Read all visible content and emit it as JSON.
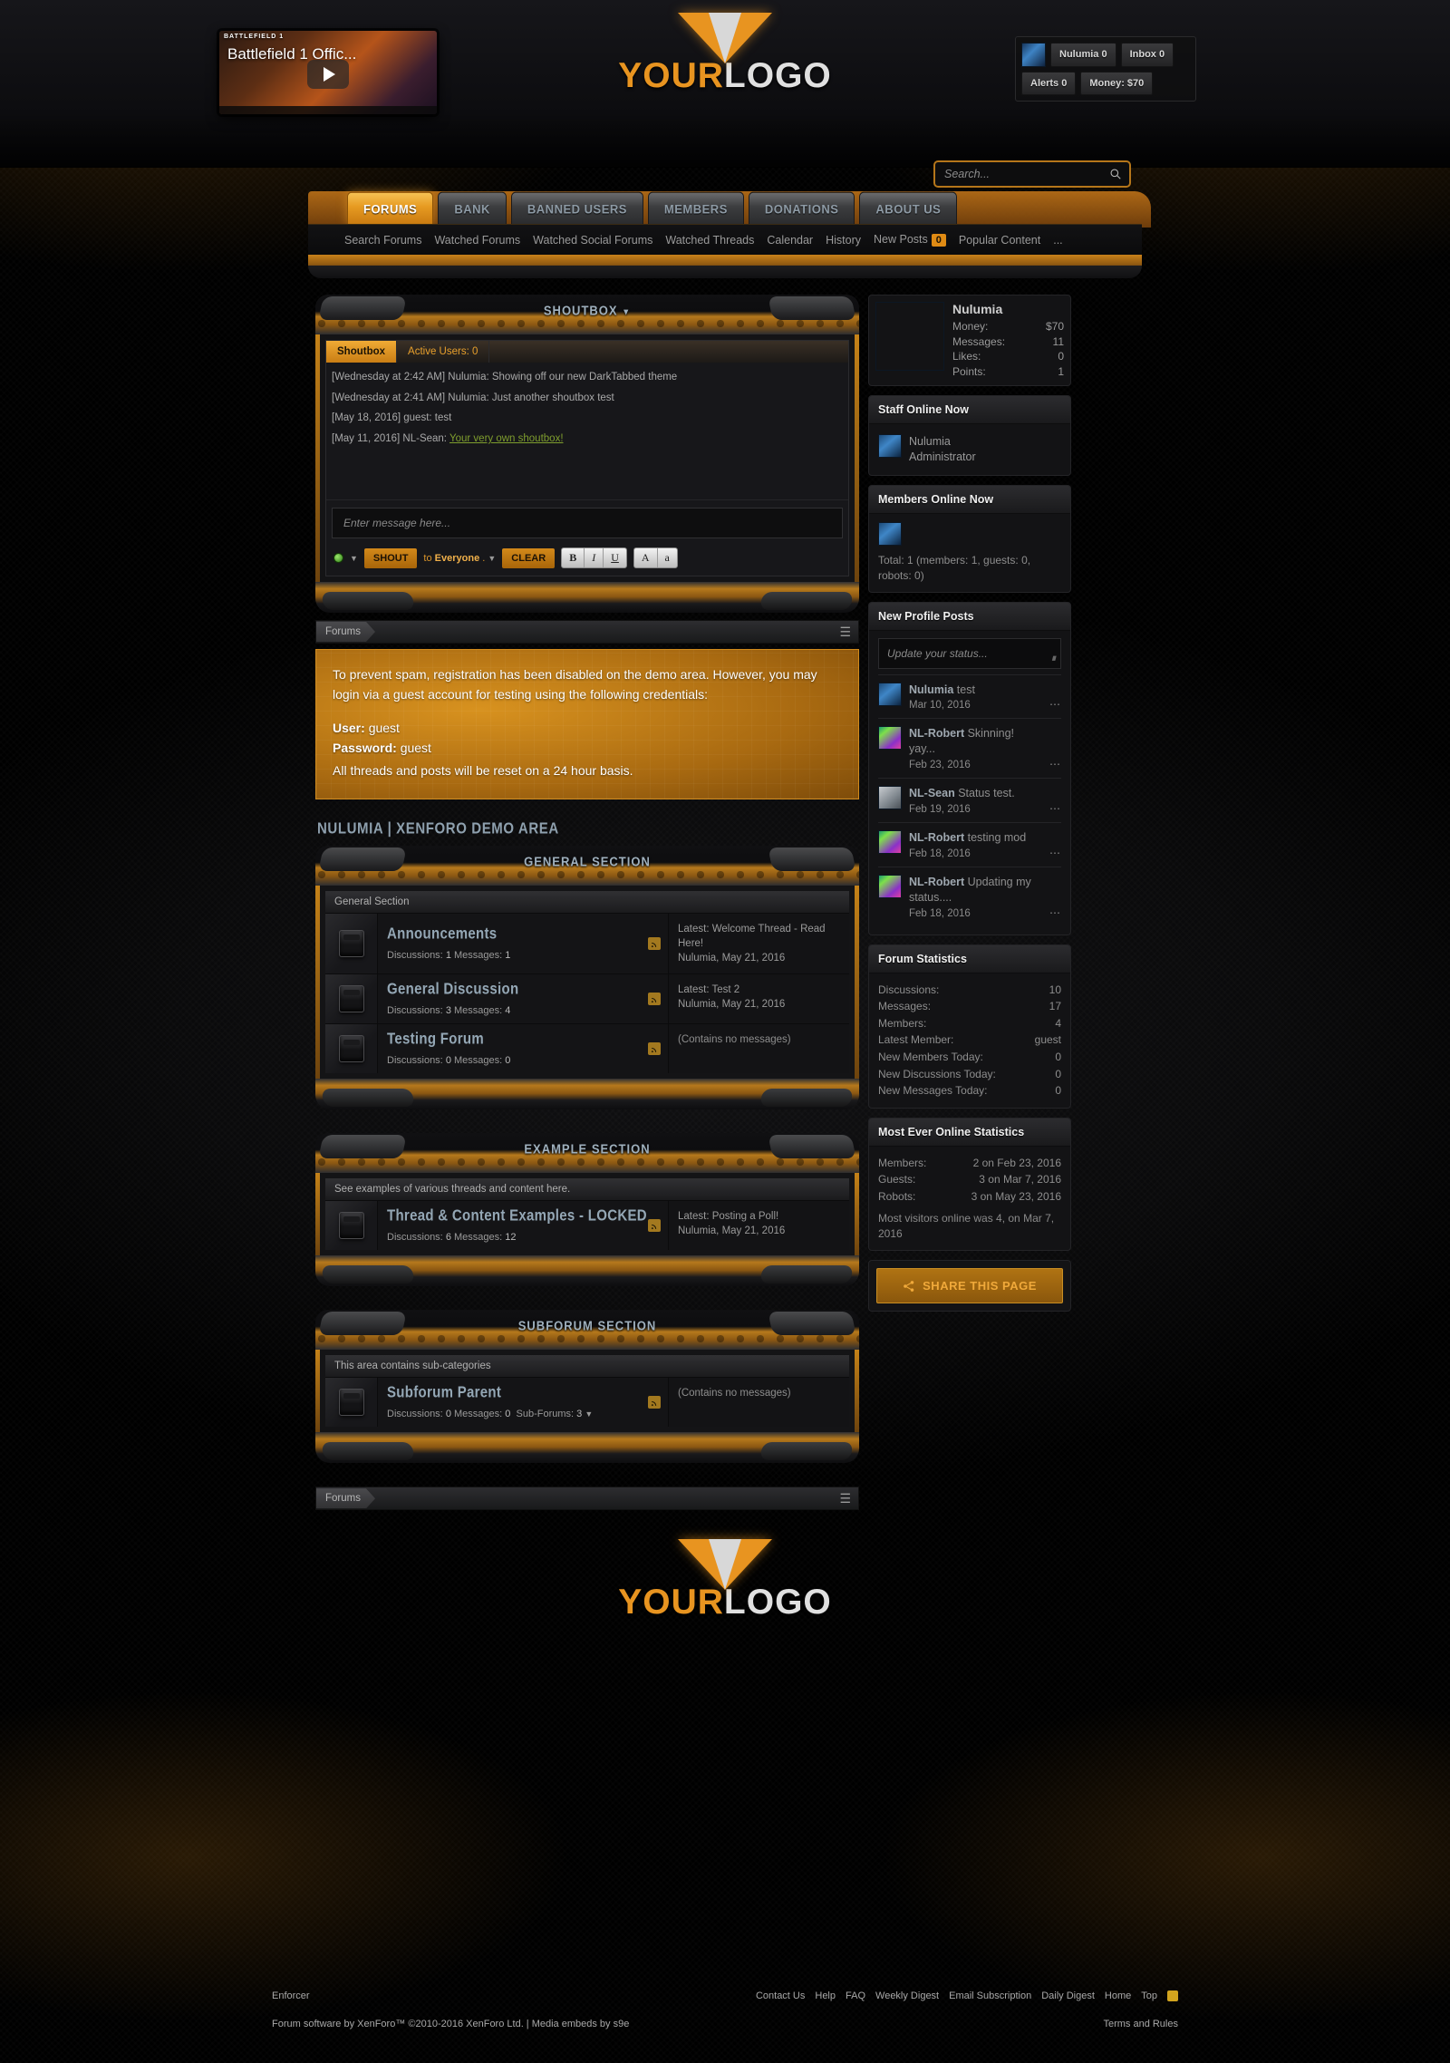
{
  "site": {
    "logo_primary": "YOUR",
    "logo_secondary": "LOGO"
  },
  "video": {
    "brand": "BATTLEFIELD 1",
    "title": "Battlefield 1 Offic..."
  },
  "account": {
    "username_label": "Nulumia 0",
    "inbox_label": "Inbox 0",
    "alerts_label": "Alerts 0",
    "money_label": "Money: $70"
  },
  "nav": {
    "tabs": [
      {
        "label": "FORUMS",
        "active": true
      },
      {
        "label": "BANK",
        "active": false
      },
      {
        "label": "BANNED USERS",
        "active": false
      },
      {
        "label": "MEMBERS",
        "active": false
      },
      {
        "label": "DONATIONS",
        "active": false
      },
      {
        "label": "ABOUT US",
        "active": false
      }
    ],
    "sub": [
      {
        "label": "Search Forums"
      },
      {
        "label": "Watched Forums"
      },
      {
        "label": "Watched Social Forums"
      },
      {
        "label": "Watched Threads"
      },
      {
        "label": "Calendar"
      },
      {
        "label": "History"
      },
      {
        "label": "New Posts",
        "badge": "0"
      },
      {
        "label": "Popular Content"
      },
      {
        "label": "..."
      }
    ]
  },
  "search": {
    "placeholder": "Search...",
    "value": "",
    "icon": "search-icon"
  },
  "shoutbox": {
    "panel_title": "SHOUTBOX",
    "tabs": [
      {
        "label": "Shoutbox",
        "active": true
      },
      {
        "label": "Active Users: 0",
        "active": false
      }
    ],
    "messages": [
      {
        "text": "[Wednesday at 2:42 AM] Nulumia: Showing off our new DarkTabbed theme",
        "link": ""
      },
      {
        "text": "[Wednesday at 2:41 AM] Nulumia: Just another shoutbox test",
        "link": ""
      },
      {
        "text": "[May 18, 2016] guest: test",
        "link": ""
      },
      {
        "text": "[May 11, 2016] NL-Sean: ",
        "link": "Your very own shoutbox!"
      }
    ],
    "input_placeholder": "Enter message here...",
    "shout_label": "SHOUT",
    "to_prefix": "to",
    "to_value": "Everyone",
    "clear_label": "CLEAR",
    "format_bold": "B",
    "format_italic": "I",
    "format_underline": "U",
    "format_color": "A",
    "format_size": "a"
  },
  "breadcrumb_top": {
    "item": "Forums"
  },
  "breadcrumb_bottom": {
    "item": "Forums"
  },
  "notice": {
    "line1": "To prevent spam, registration has been disabled on the demo area. However, you may login via a guest account for testing using the following credentials:",
    "user_label": "User:",
    "user_value": "guest",
    "password_label": "Password:",
    "password_value": "guest",
    "line2": "All threads and posts will be reset on a 24 hour basis."
  },
  "page_title": "NULUMIA | XENFORO DEMO AREA",
  "sections": [
    {
      "panel_title": "GENERAL SECTION",
      "cat_header": "General Section",
      "forums": [
        {
          "name": "Announcements",
          "discussions_label": "Discussions:",
          "discussions": "1",
          "messages_label": "Messages:",
          "messages": "1",
          "latest_prefix": "Latest: ",
          "latest_title": "Welcome Thread - Read Here!",
          "latest_meta": "Nulumia, May 21, 2016",
          "empty": ""
        },
        {
          "name": "General Discussion",
          "discussions_label": "Discussions:",
          "discussions": "3",
          "messages_label": "Messages:",
          "messages": "4",
          "latest_prefix": "Latest: ",
          "latest_title": "Test 2",
          "latest_meta": "Nulumia, May 21, 2016",
          "empty": ""
        },
        {
          "name": "Testing Forum",
          "discussions_label": "Discussions:",
          "discussions": "0",
          "messages_label": "Messages:",
          "messages": "0",
          "latest_prefix": "",
          "latest_title": "",
          "latest_meta": "",
          "empty": "(Contains no messages)"
        }
      ]
    },
    {
      "panel_title": "EXAMPLE SECTION",
      "cat_header": "See examples of various threads and content here.",
      "forums": [
        {
          "name": "Thread & Content Examples - LOCKED",
          "discussions_label": "Discussions:",
          "discussions": "6",
          "messages_label": "Messages:",
          "messages": "12",
          "latest_prefix": "Latest: ",
          "latest_title": "Posting a Poll!",
          "latest_meta": "Nulumia, May 21, 2016",
          "empty": ""
        }
      ]
    },
    {
      "panel_title": "SUBFORUM SECTION",
      "cat_header": "This area contains sub-categories",
      "forums": [
        {
          "name": "Subforum Parent",
          "discussions_label": "Discussions:",
          "discussions": "0",
          "messages_label": "Messages:",
          "messages": "0",
          "subforums_label": "Sub-Forums:",
          "subforums": "3",
          "latest_prefix": "",
          "latest_title": "",
          "latest_meta": "",
          "empty": "(Contains no messages)"
        }
      ]
    }
  ],
  "sidebar": {
    "user": {
      "name": "Nulumia",
      "rows": [
        {
          "label": "Money:",
          "value": "$70"
        },
        {
          "label": "Messages:",
          "value": "11"
        },
        {
          "label": "Likes:",
          "value": "0"
        },
        {
          "label": "Points:",
          "value": "1"
        }
      ]
    },
    "staff_online": {
      "title": "Staff Online Now",
      "members": [
        {
          "name": "Nulumia",
          "role": "Administrator"
        }
      ]
    },
    "members_online": {
      "title": "Members Online Now",
      "total": "Total: 1 (members: 1, guests: 0, robots: 0)"
    },
    "profile_posts": {
      "title": "New Profile Posts",
      "status_placeholder": "Update your status...",
      "items": [
        {
          "user": "Nulumia",
          "text": "test",
          "date": "Mar 10, 2016",
          "avatar": "blue"
        },
        {
          "user": "NL-Robert",
          "text": "Skinning! yay...",
          "date": "Feb 23, 2016",
          "avatar": "neon"
        },
        {
          "user": "NL-Sean",
          "text": "Status test.",
          "date": "Feb 19, 2016",
          "avatar": "gray"
        },
        {
          "user": "NL-Robert",
          "text": "testing mod",
          "date": "Feb 18, 2016",
          "avatar": "neon"
        },
        {
          "user": "NL-Robert",
          "text": "Updating my status....",
          "date": "Feb 18, 2016",
          "avatar": "neon"
        }
      ]
    },
    "forum_statistics": {
      "title": "Forum Statistics",
      "rows": [
        {
          "label": "Discussions:",
          "value": "10"
        },
        {
          "label": "Messages:",
          "value": "17"
        },
        {
          "label": "Members:",
          "value": "4"
        },
        {
          "label": "Latest Member:",
          "value": "guest"
        },
        {
          "label": "New Members Today:",
          "value": "0"
        },
        {
          "label": "New Discussions Today:",
          "value": "0"
        },
        {
          "label": "New Messages Today:",
          "value": "0"
        }
      ]
    },
    "most_ever_online": {
      "title": "Most Ever Online Statistics",
      "rows": [
        {
          "label": "Members:",
          "value": "2 on Feb 23, 2016"
        },
        {
          "label": "Guests:",
          "value": "3 on Mar 7, 2016"
        },
        {
          "label": "Robots:",
          "value": "3 on May 23, 2016"
        }
      ],
      "note": "Most visitors online was 4, on Mar 7, 2016"
    },
    "share": {
      "label": "SHARE THIS PAGE",
      "icon": "share-icon"
    }
  },
  "footer": {
    "style_name": "Enforcer",
    "links": [
      {
        "label": "Contact Us"
      },
      {
        "label": "Help"
      },
      {
        "label": "FAQ"
      },
      {
        "label": "Weekly Digest"
      },
      {
        "label": "Email Subscription"
      },
      {
        "label": "Daily Digest"
      },
      {
        "label": "Home"
      },
      {
        "label": "Top"
      }
    ],
    "copyright": "Forum software by XenForo™ ©2010-2016 XenForo Ltd. | Media embeds by s9e",
    "terms": "Terms and Rules"
  }
}
